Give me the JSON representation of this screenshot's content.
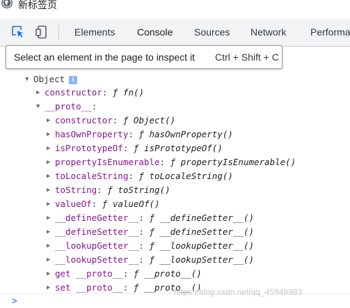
{
  "window": {
    "title": "新标签页"
  },
  "toolbar": {
    "tabs": [
      {
        "label": "Elements"
      },
      {
        "label": "Console"
      },
      {
        "label": "Sources"
      },
      {
        "label": "Network"
      },
      {
        "label": "Performa"
      }
    ],
    "active_tab": "Console"
  },
  "tooltip": {
    "text": "Select an element in the page to inspect it",
    "shortcut": "Ctrl + Shift + C"
  },
  "tree": {
    "root_label": "Object",
    "info_badge": "i",
    "constructor": {
      "key": "constructor",
      "value": "fn()"
    },
    "proto": {
      "key": "__proto__"
    },
    "proto_children": [
      {
        "key": "constructor",
        "value": "Object()"
      },
      {
        "key": "hasOwnProperty",
        "value": "hasOwnProperty()"
      },
      {
        "key": "isPrototypeOf",
        "value": "isPrototypeOf()"
      },
      {
        "key": "propertyIsEnumerable",
        "value": "propertyIsEnumerable()"
      },
      {
        "key": "toLocaleString",
        "value": "toLocaleString()"
      },
      {
        "key": "toString",
        "value": "toString()"
      },
      {
        "key": "valueOf",
        "value": "valueOf()"
      },
      {
        "key": "__defineGetter__",
        "value": "__defineGetter__()"
      },
      {
        "key": "__defineSetter__",
        "value": "__defineSetter__()"
      },
      {
        "key": "__lookupGetter__",
        "value": "__lookupGetter__()"
      },
      {
        "key": "__lookupSetter__",
        "value": "__lookupSetter__()"
      },
      {
        "key": "get __proto__",
        "value": "__proto__()"
      },
      {
        "key": "set __proto__",
        "value": "__proto__()"
      }
    ],
    "fn_symbol": "ƒ"
  },
  "console": {
    "prompt": ">"
  },
  "watermark": "https://blog.csdn.net/qq_45948983",
  "colors": {
    "accent": "#1a73e8",
    "key": "#881391",
    "inspect_icon": "#1a73e8"
  }
}
